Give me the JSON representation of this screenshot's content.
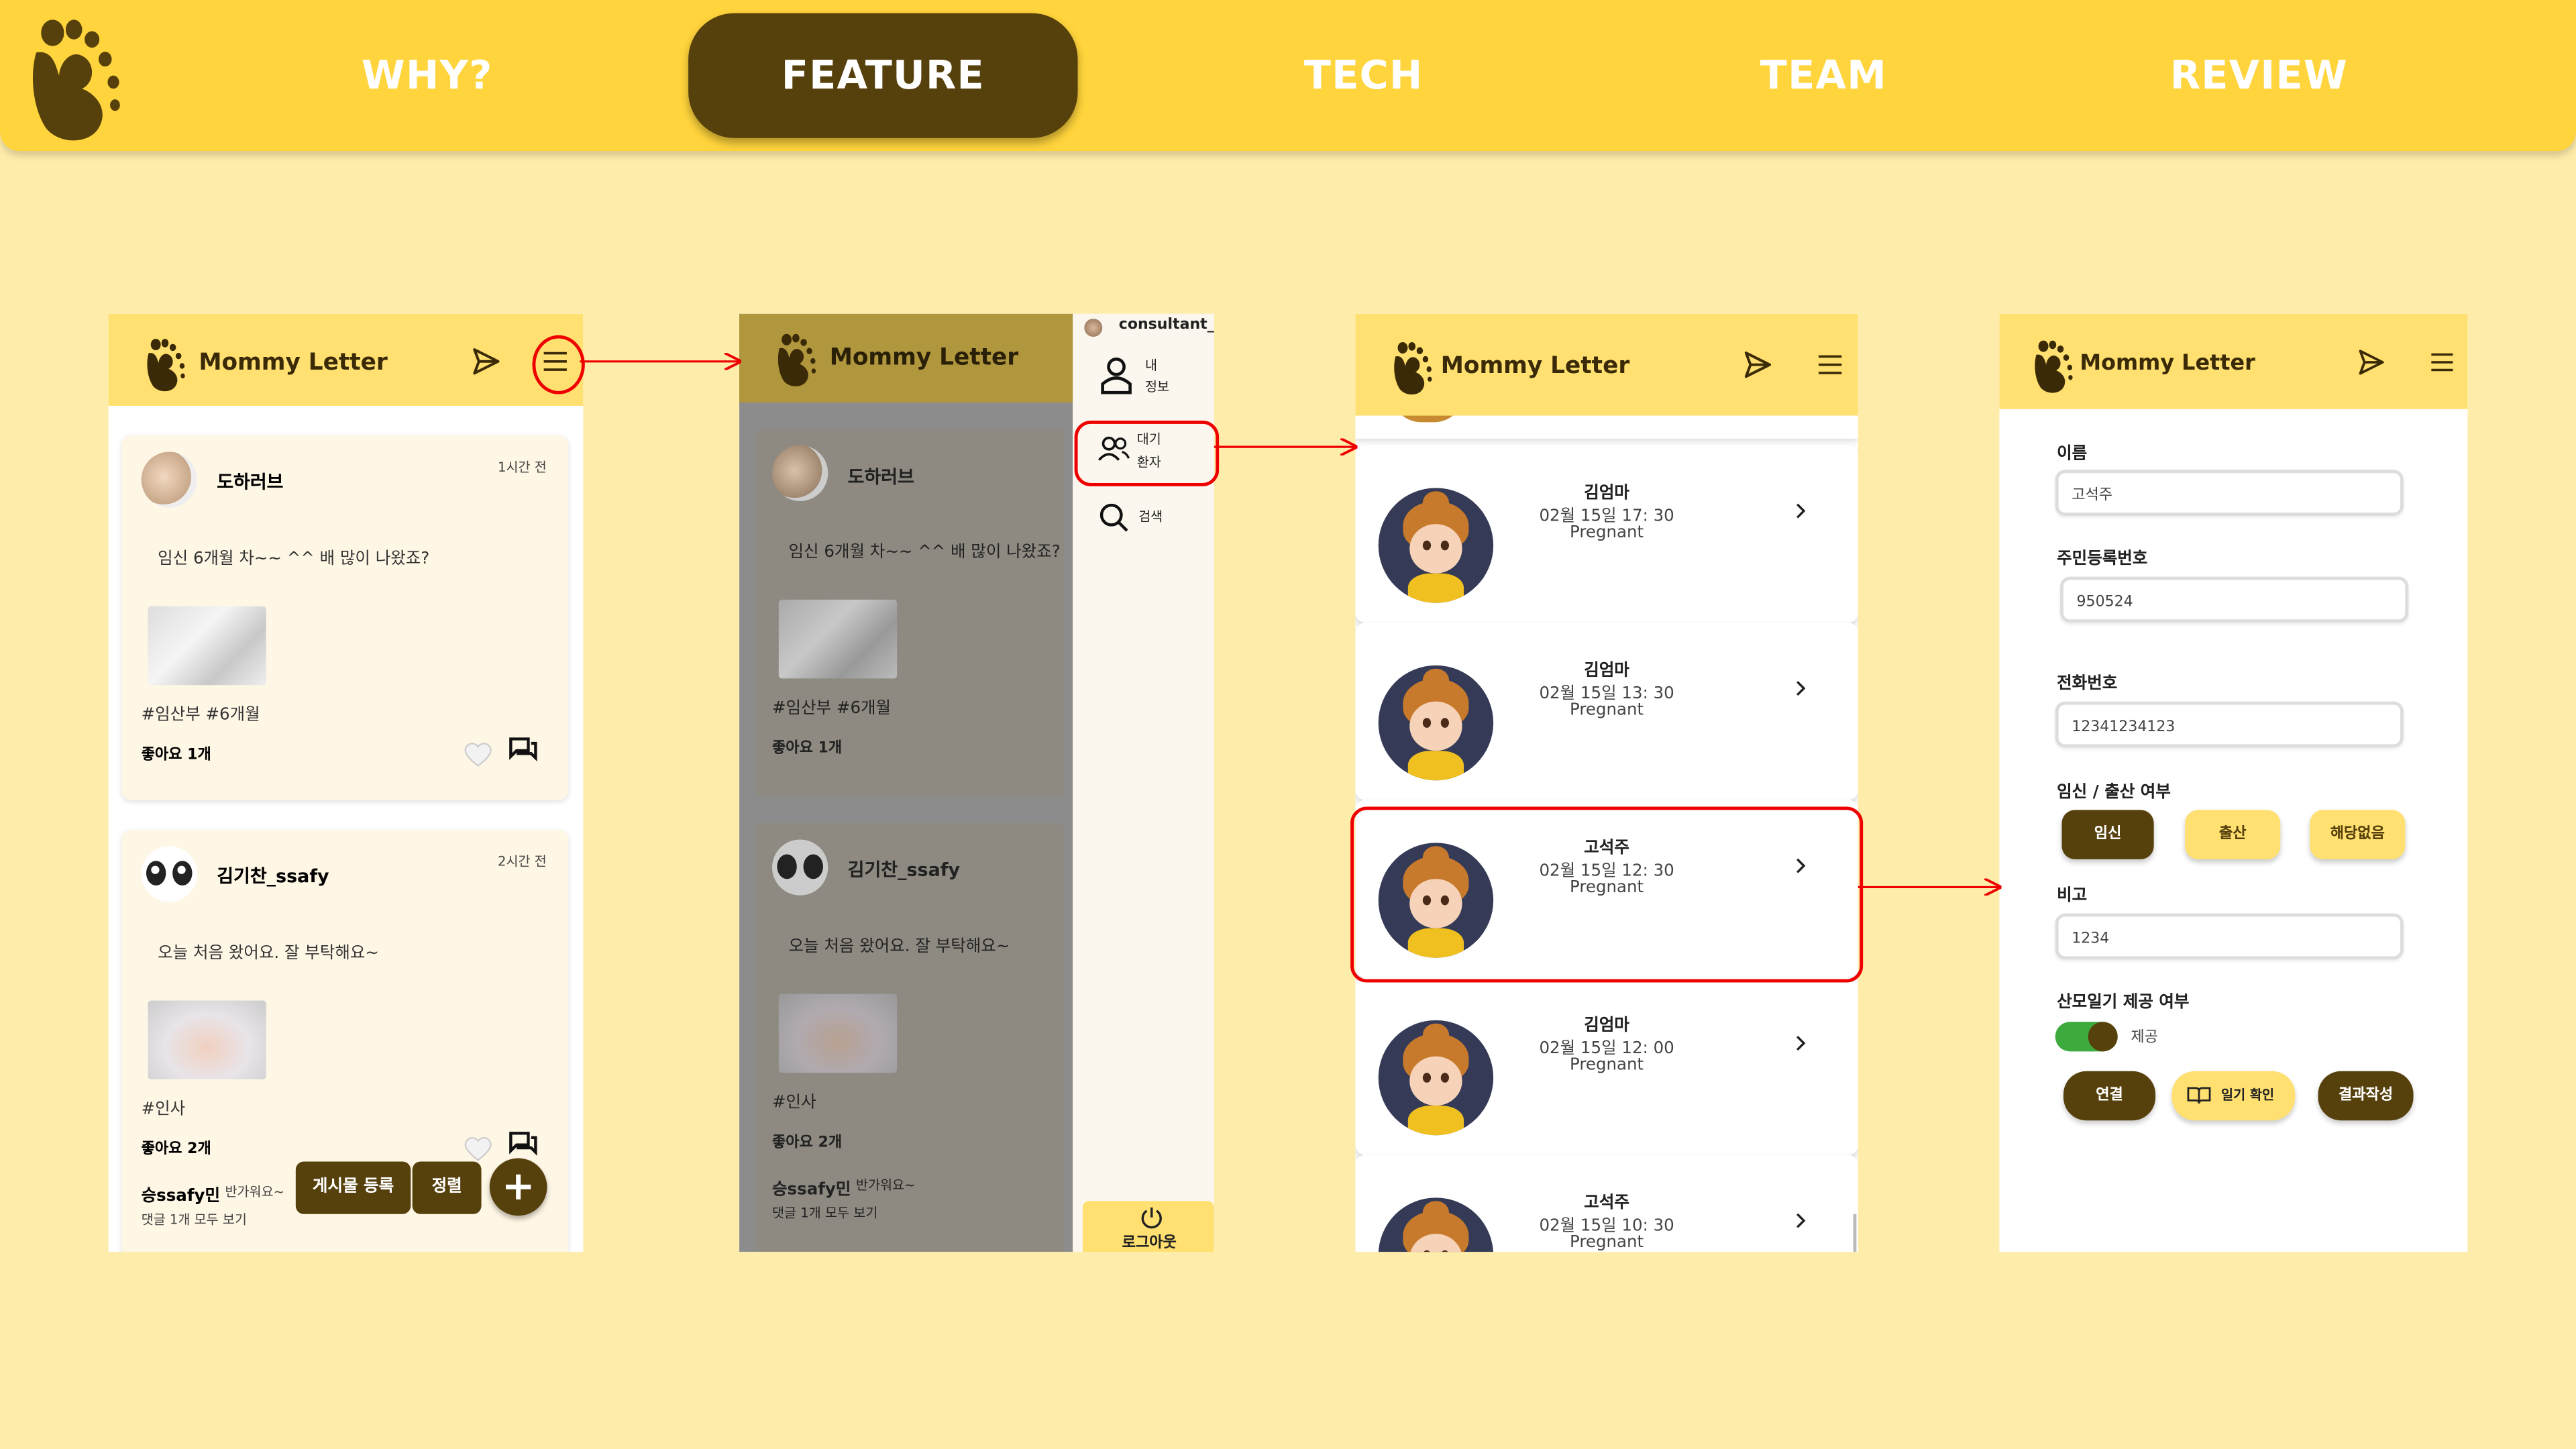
{
  "colors": {
    "yellow": "#FFD43C",
    "brown": "#56400C",
    "background": "#FEEDAA",
    "red": "#E00000",
    "green": "#3DAA3D"
  },
  "nav": {
    "items": [
      "WHY?",
      "FEATURE",
      "TECH",
      "TEAM",
      "REVIEW"
    ],
    "active": "FEATURE",
    "logo_icon": "baby-footprint-icon"
  },
  "app": {
    "title": "Mommy Letter"
  },
  "feed": {
    "posts": [
      {
        "user": "도하러브",
        "time": "1시간 전",
        "text": "임신 6개월 차~~ ^^ 배 많이 나왔죠?",
        "tags": "#임산부 #6개월",
        "likes": "좋아요 1개"
      },
      {
        "user": "김기찬_ssafy",
        "time": "2시간 전",
        "text": "오늘 처음 왔어요. 잘 부탁해요~",
        "tags": "#인사",
        "likes": "좋아요 2개",
        "comment_user": "승ssafy민",
        "comment_text": "반가워요~",
        "comment_more": "댓글 1개 모두 보기"
      }
    ],
    "buttons": {
      "register": "게시물 등록",
      "sort": "정렬",
      "add": "+"
    }
  },
  "drawer": {
    "user": "consultant_",
    "items": [
      {
        "label1": "내",
        "label2": "정보",
        "icon": "user-icon"
      },
      {
        "label1": "대기",
        "label2": "환자",
        "icon": "users-icon"
      },
      {
        "label1": "검색",
        "label2": "",
        "icon": "search-icon"
      }
    ],
    "logout": "로그아웃"
  },
  "patients": {
    "items": [
      {
        "name": "김엄마",
        "date": "02월 15일 17: 30",
        "status": "Pregnant"
      },
      {
        "name": "김엄마",
        "date": "02월 15일 13: 30",
        "status": "Pregnant"
      },
      {
        "name": "고석주",
        "date": "02월 15일 12: 30",
        "status": "Pregnant"
      },
      {
        "name": "김엄마",
        "date": "02월 15일 12: 00",
        "status": "Pregnant"
      },
      {
        "name": "고석주",
        "date": "02월 15일 10: 30",
        "status": "Pregnant"
      }
    ]
  },
  "form": {
    "name_label": "이름",
    "name_value": "고석주",
    "ssn_label": "주민등록번호",
    "ssn_value": "950524",
    "phone_label": "전화번호",
    "phone_value": "12341234123",
    "status_label": "임신 / 출산 여부",
    "status_options": [
      "임신",
      "출산",
      "해당없음"
    ],
    "status_selected": "임신",
    "note_label": "비고",
    "note_value": "1234",
    "diary_label": "산모일기 제공 여부",
    "diary_toggle_label": "제공",
    "diary_enabled": true,
    "buttons": {
      "connect": "연결",
      "diary": "일기 확인",
      "result": "결과작성"
    }
  }
}
